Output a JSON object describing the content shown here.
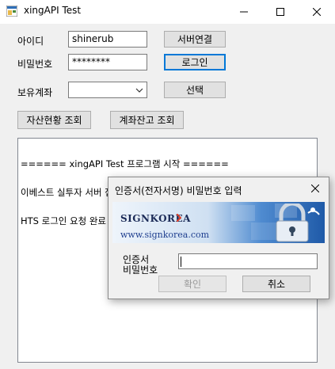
{
  "window": {
    "title": "xingAPI Test"
  },
  "login": {
    "id_label": "아이디",
    "id_value": "shinerub",
    "pw_label": "비밀번호",
    "pw_value": "********",
    "connect_button": "서버연결",
    "login_button": "로그인"
  },
  "account": {
    "label": "보유계좌",
    "selected": "",
    "select_button": "선택"
  },
  "actions": {
    "asset_query": "자산현황 조회",
    "balance_query": "계좌잔고 조회"
  },
  "log": {
    "lines": [
      "====== xingAPI Test 프로그램 시작 ======",
      "이베스트 실투자 서버 접속 완료",
      "HTS 로그인 요청 완료"
    ]
  },
  "dialog": {
    "title": "인증서(전자서명) 비밀번호 입력",
    "brand": "SIGNKOREA",
    "url": "www.signkorea.com",
    "field_label_1": "인증서",
    "field_label_2": "비밀번호",
    "password_value": "",
    "ok_button": "확인",
    "cancel_button": "취소"
  },
  "colors": {
    "banner_dark": "#2f6fb8",
    "banner_light": "#dbe8f6",
    "brand_accent": "#e0402a"
  },
  "icons": [
    "app-icon",
    "minimize-icon",
    "maximize-icon",
    "close-icon",
    "chevron-down-icon",
    "lock-icon",
    "dialog-close-icon"
  ]
}
